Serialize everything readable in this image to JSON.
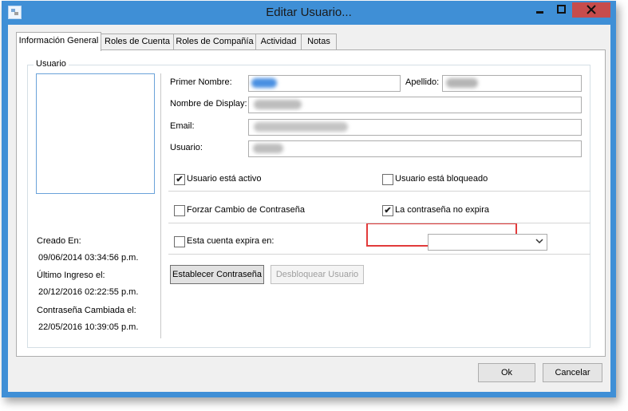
{
  "window": {
    "title": "Editar Usuario..."
  },
  "tabs": [
    "Información General",
    "Roles de Cuenta",
    "Roles de Compañía",
    "Actividad",
    "Notas"
  ],
  "group": {
    "label": "Usuario"
  },
  "fields": {
    "first_name_label": "Primer Nombre:",
    "last_name_label": "Apellido:",
    "display_name_label": "Nombre de Display:",
    "email_label": "Email:",
    "username_label": "Usuario:"
  },
  "info": {
    "created_label": "Creado En:",
    "created_value": "09/06/2014 03:34:56 p.m.",
    "last_login_label": "Último Ingreso el:",
    "last_login_value": "20/12/2016 02:22:55 p.m.",
    "password_changed_label": "Contraseña Cambiada el:",
    "password_changed_value": "22/05/2016 10:39:05 p.m."
  },
  "checks": {
    "active": {
      "label": "Usuario está activo",
      "checked": true
    },
    "locked": {
      "label": "Usuario está bloqueado",
      "checked": false
    },
    "force_change": {
      "label": "Forzar Cambio de Contraseña",
      "checked": false
    },
    "never_expires": {
      "label": "La contraseña no expira",
      "checked": true
    },
    "account_expires": {
      "label": "Esta cuenta expira en:",
      "checked": false
    }
  },
  "buttons": {
    "set_password": "Establecer Contraseña",
    "unlock_user": "Desbloquear Usuario",
    "ok": "Ok",
    "cancel": "Cancelar"
  },
  "colors": {
    "title_bar": "#3f8fd6",
    "close_button": "#c74c4c",
    "highlight": "#e23b3b"
  }
}
